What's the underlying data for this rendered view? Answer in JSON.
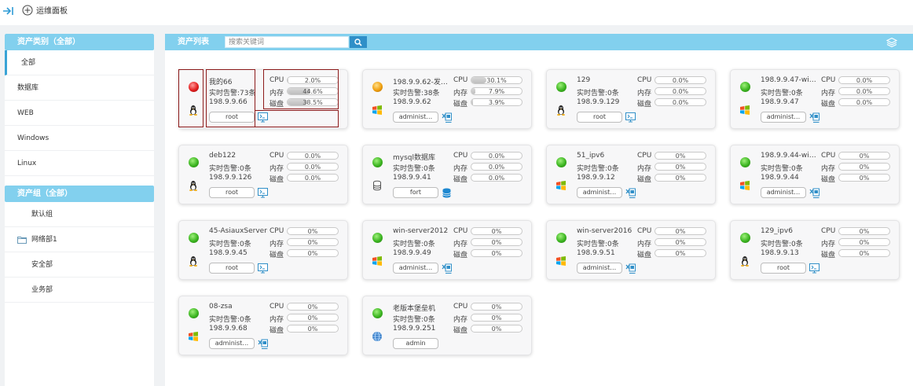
{
  "header": {
    "title": "运维面板"
  },
  "sidebar": {
    "asset_type_title": "资产类别（全部）",
    "asset_types": [
      "全部",
      "数据库",
      "WEB",
      "Windows",
      "Linux"
    ],
    "group_title": "资产组（全部）",
    "groups": [
      "默认组",
      "网络部1",
      "安全部",
      "业务部"
    ]
  },
  "main": {
    "title": "资产列表",
    "search_placeholder": "搜索关键词"
  },
  "labels": {
    "cpu": "CPU",
    "mem": "内存",
    "disk": "磁盘"
  },
  "colors": {
    "accent": "#82d0ee",
    "button": "#2f8fc8",
    "status_green": "#3cb521",
    "status_red": "#e32020",
    "status_orange": "#f0a010",
    "highlight": "#8c1a1a"
  },
  "cards": [
    {
      "name": "我的66",
      "alarm": "实时告警:73条",
      "ip": "198.9.9.66",
      "status": "red",
      "os": "linux",
      "user": "root",
      "tool": "screen",
      "cpu": "2.0%",
      "cpu_v": 2.0,
      "mem": "44.6%",
      "mem_v": 44.6,
      "disk": "38.5%",
      "disk_v": 38.5
    },
    {
      "name": "198.9.9.62-发…",
      "alarm": "实时告警:38条",
      "ip": "198.9.9.62",
      "status": "orange",
      "os": "windows",
      "user": "administ…",
      "tool": "remote",
      "cpu": "30.1%",
      "cpu_v": 30.1,
      "mem": "7.9%",
      "mem_v": 7.9,
      "disk": "3.9%",
      "disk_v": 3.9
    },
    {
      "name": "129",
      "alarm": "实时告警:0条",
      "ip": "198.9.9.129",
      "status": "green",
      "os": "linux",
      "user": "root",
      "tool": "screen",
      "cpu": "0.0%",
      "cpu_v": 0,
      "mem": "0.0%",
      "mem_v": 0,
      "disk": "0.0%",
      "disk_v": 0
    },
    {
      "name": "198.9.9.47-wi…",
      "alarm": "实时告警:0条",
      "ip": "198.9.9.47",
      "status": "green",
      "os": "windows",
      "user": "administ…",
      "tool": "remote",
      "cpu": "0.0%",
      "cpu_v": 0,
      "mem": "0.0%",
      "mem_v": 0,
      "disk": "0.0%",
      "disk_v": 0
    },
    {
      "name": "deb122",
      "alarm": "实时告警:0条",
      "ip": "198.9.9.126",
      "status": "green",
      "os": "linux",
      "user": "root",
      "tool": "screen",
      "cpu": "0.0%",
      "cpu_v": 0,
      "mem": "0.0%",
      "mem_v": 0,
      "disk": "0.0%",
      "disk_v": 0
    },
    {
      "name": "mysql数据库",
      "alarm": "实时告警:0条",
      "ip": "198.9.9.41",
      "status": "green",
      "os": "database",
      "user": "fort",
      "tool": "database",
      "cpu": "0.0%",
      "cpu_v": 0,
      "mem": "0.0%",
      "mem_v": 0,
      "disk": "0.0%",
      "disk_v": 0
    },
    {
      "name": "51_ipv6",
      "alarm": "实时告警:0条",
      "ip": "198.9.9.12",
      "status": "green",
      "os": "windows",
      "user": "administ…",
      "tool": "remote",
      "cpu": "0%",
      "cpu_v": 0,
      "mem": "0%",
      "mem_v": 0,
      "disk": "0%",
      "disk_v": 0
    },
    {
      "name": "198.9.9.44-wi…",
      "alarm": "实时告警:0条",
      "ip": "198.9.9.44",
      "status": "green",
      "os": "windows",
      "user": "administ…",
      "tool": "remote",
      "cpu": "0%",
      "cpu_v": 0,
      "mem": "0%",
      "mem_v": 0,
      "disk": "0%",
      "disk_v": 0
    },
    {
      "name": "45-AsiauxServer",
      "alarm": "实时告警:0条",
      "ip": "198.9.9.45",
      "status": "green",
      "os": "linux",
      "user": "root",
      "tool": "screen",
      "cpu": "0%",
      "cpu_v": 0,
      "mem": "0%",
      "mem_v": 0,
      "disk": "0%",
      "disk_v": 0
    },
    {
      "name": "win-server2012",
      "alarm": "实时告警:0条",
      "ip": "198.9.9.49",
      "status": "green",
      "os": "windows",
      "user": "administ…",
      "tool": "remote",
      "cpu": "0%",
      "cpu_v": 0,
      "mem": "0%",
      "mem_v": 0,
      "disk": "0%",
      "disk_v": 0
    },
    {
      "name": "win-server2016",
      "alarm": "实时告警:0条",
      "ip": "198.9.9.51",
      "status": "green",
      "os": "windows",
      "user": "administ…",
      "tool": "remote",
      "cpu": "0%",
      "cpu_v": 0,
      "mem": "0%",
      "mem_v": 0,
      "disk": "0%",
      "disk_v": 0
    },
    {
      "name": "129_ipv6",
      "alarm": "实时告警:0条",
      "ip": "198.9.9.13",
      "status": "green",
      "os": "linux",
      "user": "root",
      "tool": "screen",
      "cpu": "0%",
      "cpu_v": 0,
      "mem": "0%",
      "mem_v": 0,
      "disk": "0%",
      "disk_v": 0
    },
    {
      "name": "08-zsa",
      "alarm": "实时告警:0条",
      "ip": "198.9.9.68",
      "status": "green",
      "os": "windows",
      "user": "administ…",
      "tool": "remote",
      "cpu": "0%",
      "cpu_v": 0,
      "mem": "0%",
      "mem_v": 0,
      "disk": "0%",
      "disk_v": 0
    },
    {
      "name": "老版本堡垒机",
      "alarm": "实时告警:0条",
      "ip": "198.9.9.251",
      "status": "green",
      "os": "web",
      "user": "admin",
      "tool": "none",
      "cpu": "0%",
      "cpu_v": 0,
      "mem": "0%",
      "mem_v": 0,
      "disk": "0%",
      "disk_v": 0
    }
  ]
}
